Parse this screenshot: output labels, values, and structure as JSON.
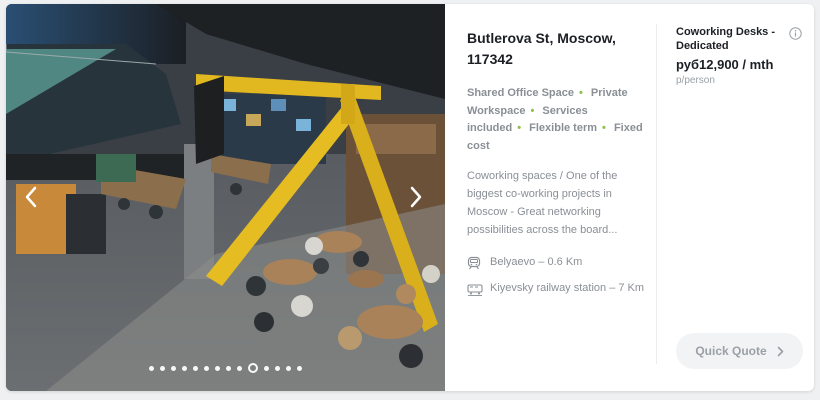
{
  "listing": {
    "address": "Butlerova St, Moscow, 117342",
    "features": [
      "Shared Office Space",
      "Private Workspace",
      "Services included",
      "Flexible term",
      "Fixed cost"
    ],
    "feature_separator": "•",
    "description": "Coworking spaces / One of the biggest co-working projects in Moscow - Great networking possibilities across the board...",
    "transport": [
      {
        "icon": "metro-icon",
        "text": "Belyaevo  –  0.6 Km"
      },
      {
        "icon": "train-icon",
        "text": "Kiyevsky railway station  –  7 Km"
      }
    ]
  },
  "gallery": {
    "image_count": 14,
    "active_index": 9,
    "prev_icon": "chevron-left-icon",
    "next_icon": "chevron-right-icon"
  },
  "pricing": {
    "type": "Coworking Desks - Dedicated",
    "price": "руб12,900 / mth",
    "unit": "p/person",
    "info_icon": "info-icon"
  },
  "cta": {
    "label": "Quick Quote",
    "icon": "chevron-right-icon"
  },
  "colors": {
    "accent_bullet": "#8fc04b",
    "text_dark": "#1c1f24",
    "text_muted": "#8a8f96",
    "button_bg": "#f2f3f5"
  }
}
